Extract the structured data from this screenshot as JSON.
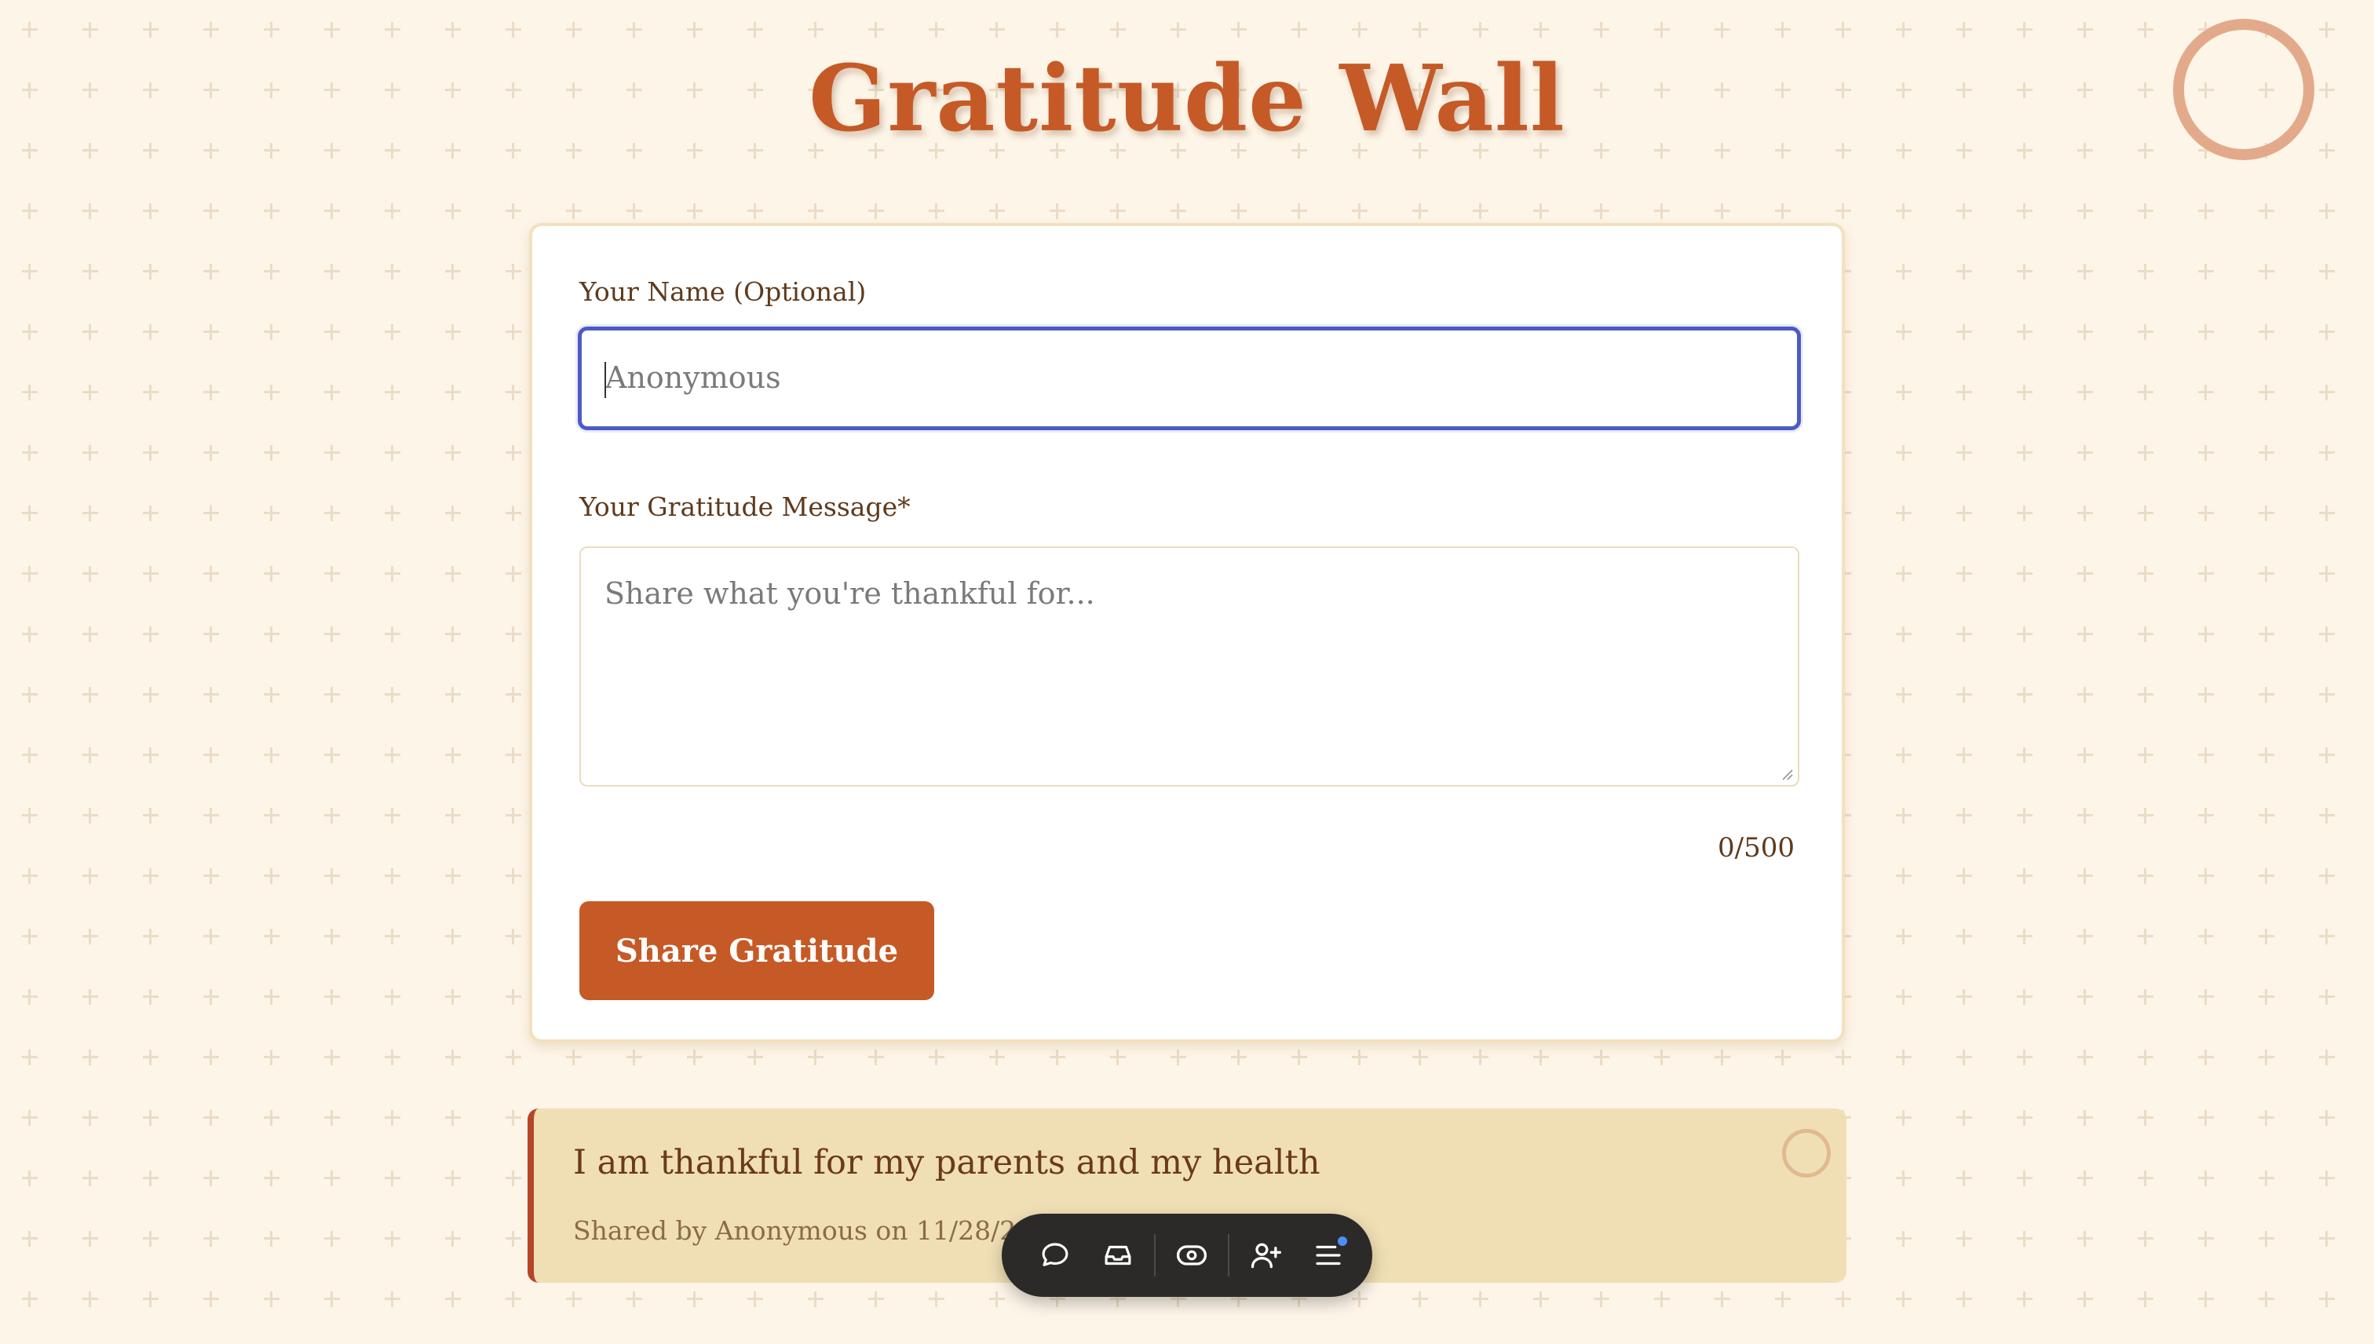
{
  "page": {
    "title": "Gratitude Wall"
  },
  "form": {
    "name_label": "Your Name (Optional)",
    "name_placeholder": "Anonymous",
    "name_value": "",
    "message_label": "Your Gratitude Message*",
    "message_placeholder": "Share what you're thankful for...",
    "message_value": "",
    "char_count": "0/500",
    "submit_label": "Share Gratitude"
  },
  "entries": [
    {
      "message": "I am thankful for my parents and my health",
      "meta": "Shared by Anonymous on 11/28/202"
    }
  ],
  "toolbar": {
    "items": [
      {
        "icon": "comment-icon"
      },
      {
        "icon": "inbox-icon"
      },
      {
        "icon": "eye-icon"
      },
      {
        "icon": "add-user-icon"
      },
      {
        "icon": "menu-icon",
        "has_notification": true
      }
    ]
  },
  "colors": {
    "accent": "#c55a27",
    "background": "#fdf5e8",
    "entry_background": "#f0dfb5",
    "entry_border": "#b64528",
    "focus_border": "#4d5ac4",
    "toolbar": "#2b2a28",
    "notification_dot": "#4e8ef7"
  }
}
